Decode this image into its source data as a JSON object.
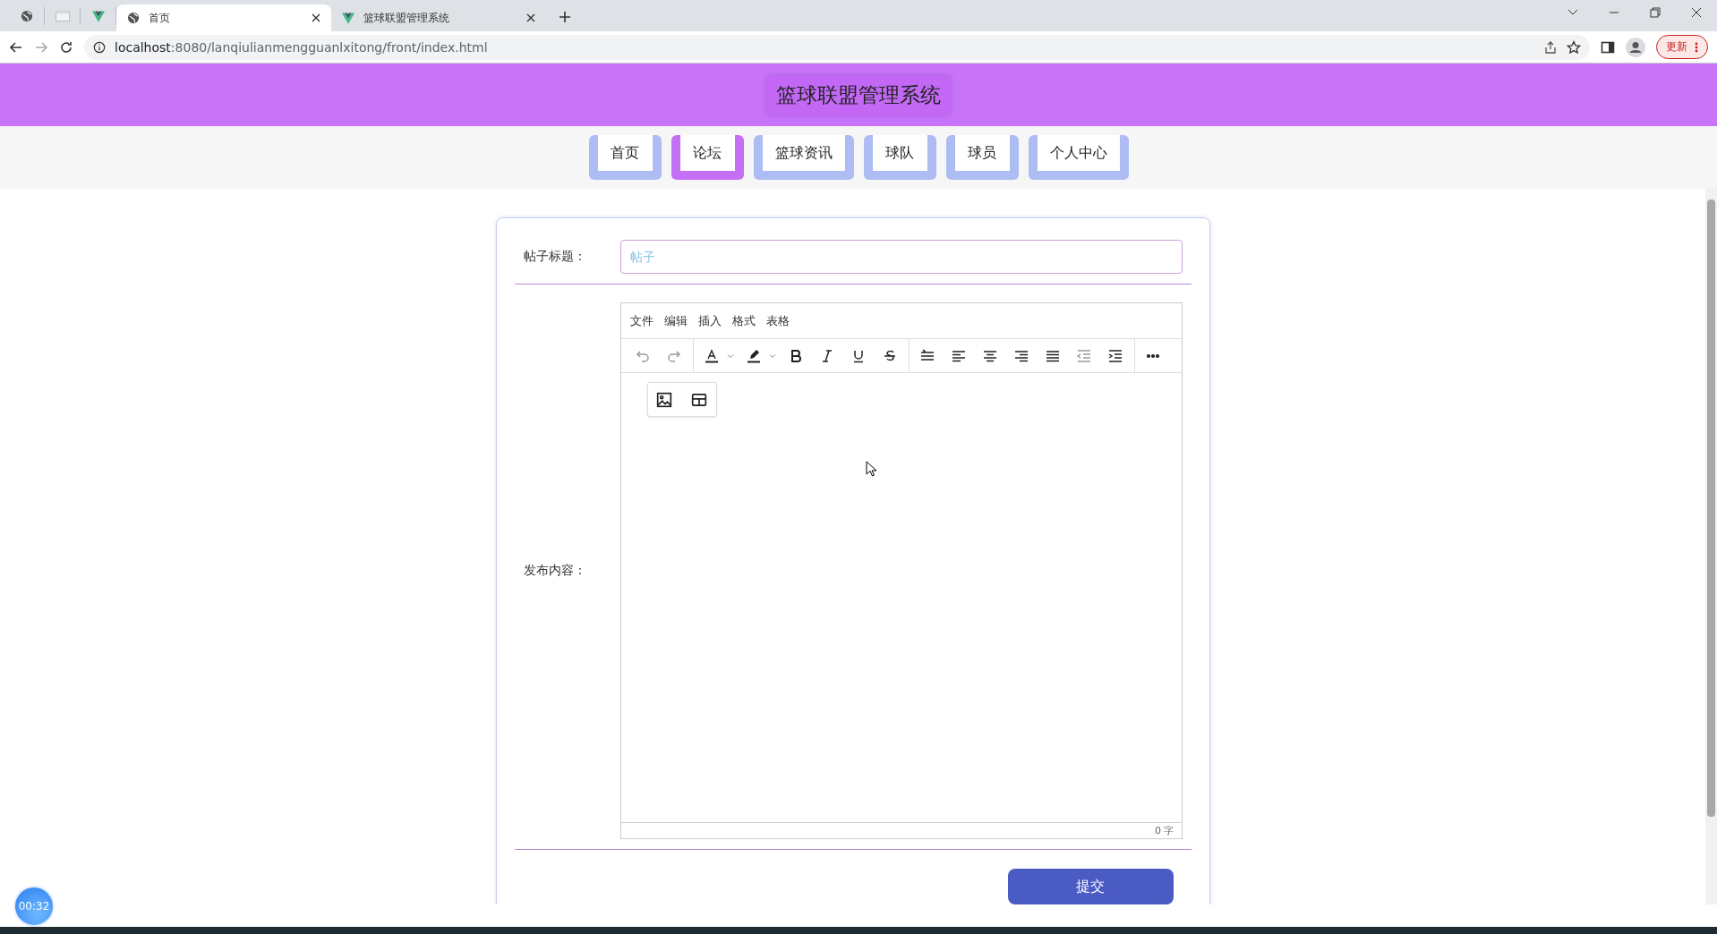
{
  "browser": {
    "tabs": [
      {
        "kind": "globe",
        "title": "首页",
        "selected": true
      },
      {
        "kind": "vue",
        "title": "篮球联盟管理系统",
        "selected": false
      }
    ],
    "url_host": "localhost",
    "url_path": ":8080/lanqiulianmengguanlxitong/front/index.html",
    "update_button": "更新"
  },
  "site_title": "篮球联盟管理系统",
  "nav": [
    {
      "label": "首页",
      "selected": false
    },
    {
      "label": "论坛",
      "selected": true
    },
    {
      "label": "篮球资讯",
      "selected": false
    },
    {
      "label": "球队",
      "selected": false
    },
    {
      "label": "球员",
      "selected": false
    },
    {
      "label": "个人中心",
      "selected": false
    }
  ],
  "form": {
    "title_label": "帖子标题：",
    "title_placeholder": "帖子",
    "content_label": "发布内容：",
    "editor": {
      "menu": [
        "文件",
        "编辑",
        "插入",
        "格式",
        "表格"
      ],
      "word_count": "0 字"
    },
    "submit": "提交"
  },
  "timer": "00:32"
}
